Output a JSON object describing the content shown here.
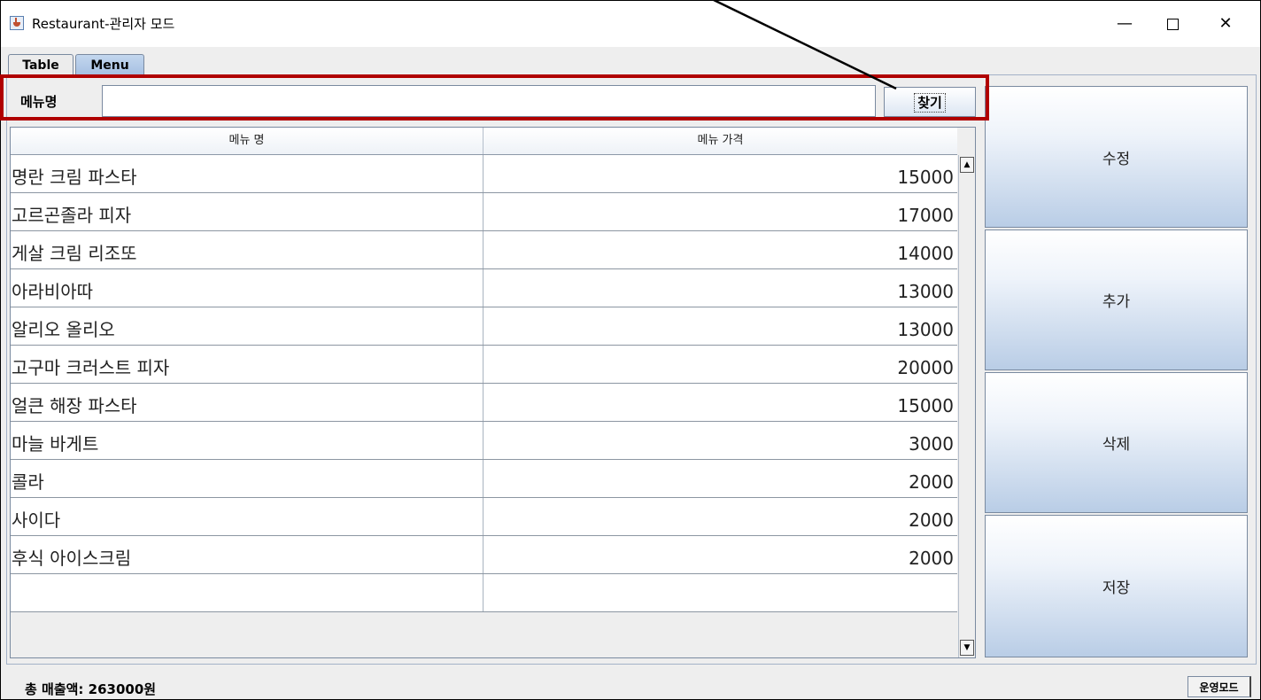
{
  "window": {
    "title": "Restaurant-관리자 모드",
    "controls": {
      "minimize": "—",
      "close": "✕"
    }
  },
  "tabs": [
    {
      "label": "Table"
    },
    {
      "label": "Menu"
    }
  ],
  "search": {
    "label": "메뉴명",
    "input_value": "",
    "button_label": "찾기"
  },
  "table": {
    "headers": [
      "메뉴 명",
      "메뉴 가격"
    ],
    "rows": [
      {
        "name": "명란 크림 파스타",
        "price": "15000"
      },
      {
        "name": "고르곤졸라 피자",
        "price": "17000"
      },
      {
        "name": "게살 크림 리조또",
        "price": "14000"
      },
      {
        "name": "아라비아따",
        "price": "13000"
      },
      {
        "name": "알리오 올리오",
        "price": "13000"
      },
      {
        "name": "고구마 크러스트 피자",
        "price": "20000"
      },
      {
        "name": "얼큰 해장 파스타",
        "price": "15000"
      },
      {
        "name": "마늘 바게트",
        "price": "3000"
      },
      {
        "name": "콜라",
        "price": "2000"
      },
      {
        "name": "사이다",
        "price": "2000"
      },
      {
        "name": "후식 아이스크림",
        "price": "2000"
      },
      {
        "name": "",
        "price": ""
      }
    ]
  },
  "actions": {
    "edit": "수정",
    "add": "추가",
    "delete": "삭제",
    "save": "저장"
  },
  "status": {
    "total_sales": "총 매출액: 263000원",
    "mode_button": "운영모드"
  },
  "icons": {
    "app": "java-cup-icon",
    "scroll_up": "arrow-up-icon",
    "scroll_down": "arrow-down-icon"
  },
  "colors": {
    "highlight": "#b00000",
    "tab_active": "#a6c0e2",
    "button_gradient_end": "#b9cde6"
  }
}
